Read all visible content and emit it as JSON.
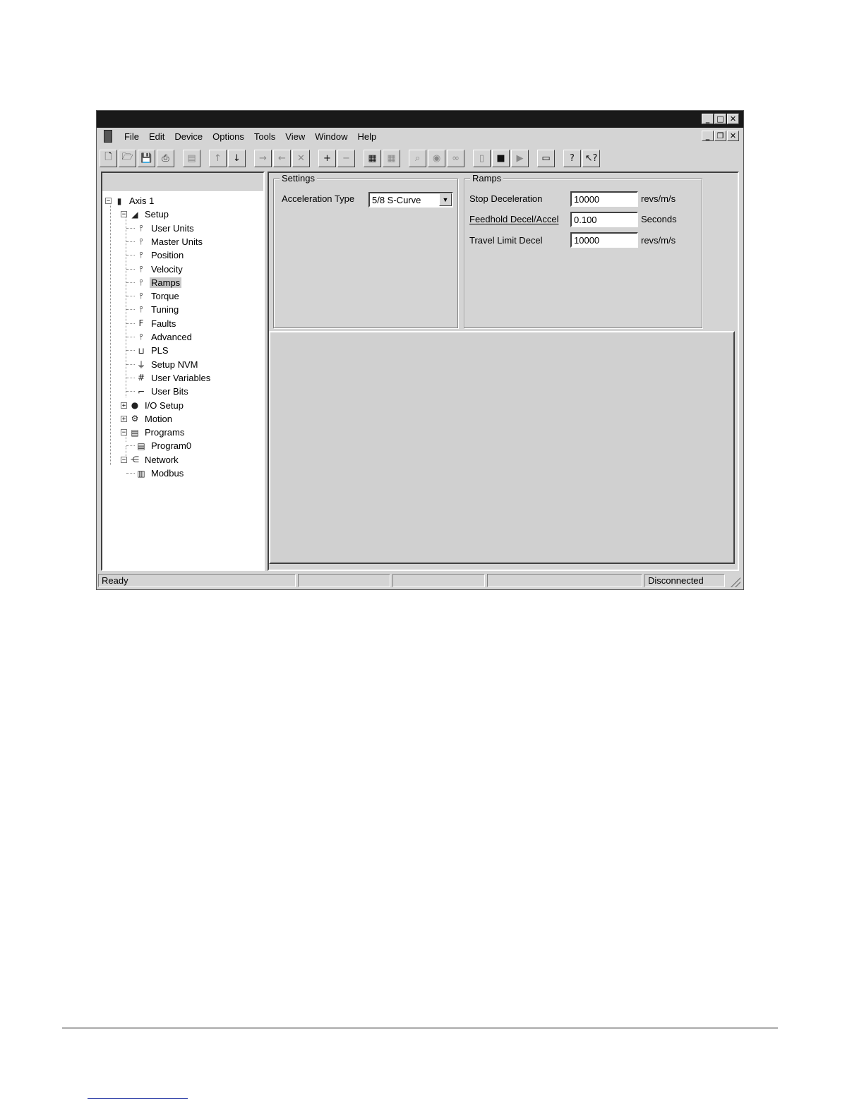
{
  "window": {
    "title": "",
    "controls": {
      "minimize": "_",
      "maximize": "□",
      "close": "✕",
      "restore": "❐"
    }
  },
  "menubar": {
    "items": [
      "File",
      "Edit",
      "Device",
      "Options",
      "Tools",
      "View",
      "Window",
      "Help"
    ]
  },
  "toolbar": {
    "buttons": [
      {
        "name": "new-file-icon",
        "glyph": "🗋"
      },
      {
        "name": "open-folder-icon",
        "glyph": "🗁"
      },
      {
        "name": "save-icon",
        "glyph": "💾"
      },
      {
        "name": "print-icon",
        "glyph": "⎙"
      },
      {
        "name": "properties-icon",
        "glyph": "▤"
      },
      {
        "name": "upload-icon",
        "glyph": "↑"
      },
      {
        "name": "download-icon",
        "glyph": "↓"
      },
      {
        "name": "connect-icon",
        "glyph": "→"
      },
      {
        "name": "disconnect-icon",
        "glyph": "←"
      },
      {
        "name": "cancel-icon",
        "glyph": "✕"
      },
      {
        "name": "add-axis-icon",
        "glyph": "+"
      },
      {
        "name": "remove-axis-icon",
        "glyph": "−"
      },
      {
        "name": "program-icon",
        "glyph": "▦"
      },
      {
        "name": "program-disabled-icon",
        "glyph": "▦"
      },
      {
        "name": "watch-icon",
        "glyph": "⌕"
      },
      {
        "name": "monitor-icon",
        "glyph": "◉"
      },
      {
        "name": "glasses-icon",
        "glyph": "∞"
      },
      {
        "name": "drive-icon",
        "glyph": "▯"
      },
      {
        "name": "stop-icon",
        "glyph": "■"
      },
      {
        "name": "run-icon",
        "glyph": "▶"
      },
      {
        "name": "window-icon",
        "glyph": "▭"
      },
      {
        "name": "help-icon",
        "glyph": "?"
      },
      {
        "name": "context-help-icon",
        "glyph": "↖?"
      }
    ]
  },
  "tree": {
    "nodes": [
      {
        "label": "Axis 1",
        "icon": "axis-drive-icon",
        "glyph": "▮",
        "expander": "−",
        "depth": 0,
        "selected": false
      },
      {
        "label": "Setup",
        "icon": "setup-icon",
        "glyph": "◢",
        "expander": "−",
        "depth": 1,
        "selected": false
      },
      {
        "label": "User Units",
        "icon": "setup-item-icon",
        "glyph": "⫯",
        "expander": "",
        "depth": 2,
        "selected": false
      },
      {
        "label": "Master Units",
        "icon": "setup-item-icon",
        "glyph": "⫯",
        "expander": "",
        "depth": 2,
        "selected": false
      },
      {
        "label": "Position",
        "icon": "setup-item-icon",
        "glyph": "⫯",
        "expander": "",
        "depth": 2,
        "selected": false
      },
      {
        "label": "Velocity",
        "icon": "setup-item-icon",
        "glyph": "⫯",
        "expander": "",
        "depth": 2,
        "selected": false
      },
      {
        "label": "Ramps",
        "icon": "setup-item-icon",
        "glyph": "⫯",
        "expander": "",
        "depth": 2,
        "selected": true
      },
      {
        "label": "Torque",
        "icon": "setup-item-icon",
        "glyph": "⫯",
        "expander": "",
        "depth": 2,
        "selected": false
      },
      {
        "label": "Tuning",
        "icon": "setup-item-icon",
        "glyph": "⫯",
        "expander": "",
        "depth": 2,
        "selected": false
      },
      {
        "label": "Faults",
        "icon": "faults-icon",
        "glyph": "F",
        "expander": "",
        "depth": 2,
        "selected": false
      },
      {
        "label": "Advanced",
        "icon": "setup-item-icon",
        "glyph": "⫯",
        "expander": "",
        "depth": 2,
        "selected": false
      },
      {
        "label": "PLS",
        "icon": "pls-icon",
        "glyph": "⊔",
        "expander": "",
        "depth": 2,
        "selected": false
      },
      {
        "label": "Setup NVM",
        "icon": "nvm-icon",
        "glyph": "⏚",
        "expander": "",
        "depth": 2,
        "selected": false
      },
      {
        "label": "User Variables",
        "icon": "user-variables-icon",
        "glyph": "#",
        "expander": "",
        "depth": 2,
        "selected": false
      },
      {
        "label": "User Bits",
        "icon": "user-bits-icon",
        "glyph": "⌐",
        "expander": "",
        "depth": 2,
        "selected": false
      },
      {
        "label": "I/O Setup",
        "icon": "io-setup-icon",
        "glyph": "●",
        "expander": "+",
        "depth": 1,
        "selected": false
      },
      {
        "label": "Motion",
        "icon": "motion-icon",
        "glyph": "⚙",
        "expander": "+",
        "depth": 1,
        "selected": false
      },
      {
        "label": "Programs",
        "icon": "programs-icon",
        "glyph": "▤",
        "expander": "−",
        "depth": 1,
        "selected": false
      },
      {
        "label": "Program0",
        "icon": "program-icon",
        "glyph": "▤",
        "expander": "",
        "depth": 2,
        "selected": false
      },
      {
        "label": "Network",
        "icon": "network-icon",
        "glyph": "⋲",
        "expander": "−",
        "depth": 1,
        "selected": false
      },
      {
        "label": "Modbus",
        "icon": "modbus-icon",
        "glyph": "▥",
        "expander": "",
        "depth": 2,
        "selected": false
      }
    ]
  },
  "settings": {
    "legend": "Settings",
    "acceleration_type_label": "Acceleration Type",
    "acceleration_type_value": "5/8 S-Curve"
  },
  "ramps": {
    "legend": "Ramps",
    "fields": [
      {
        "label": "Stop Deceleration",
        "value": "10000",
        "unit": "revs/m/s"
      },
      {
        "label": "Feedhold Decel/Accel",
        "value": "0.100",
        "unit": "Seconds"
      },
      {
        "label": "Travel Limit Decel",
        "value": "10000",
        "unit": "revs/m/s"
      }
    ]
  },
  "statusbar": {
    "status": "Ready",
    "connection": "Disconnected"
  }
}
